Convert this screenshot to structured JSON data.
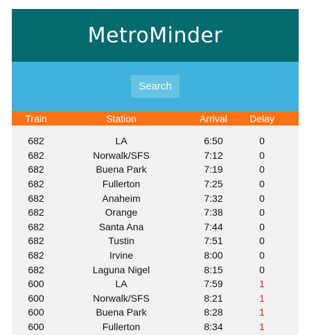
{
  "app": {
    "title": "MetroMinder"
  },
  "search": {
    "button_label": "Search"
  },
  "colors": {
    "header": "#036a6e",
    "search_bar": "#3fb3dc",
    "table_header": "#fd7217",
    "delay": "#e61e1e"
  },
  "table": {
    "headers": {
      "train": "Train",
      "station": "Station",
      "arrival": "Arrival",
      "delay": "Delay"
    },
    "rows": [
      {
        "train": "682",
        "station": "LA",
        "arrival": "6:50",
        "delay": "0"
      },
      {
        "train": "682",
        "station": "Norwalk/SFS",
        "arrival": "7:12",
        "delay": "0"
      },
      {
        "train": "682",
        "station": "Buena Park",
        "arrival": "7:19",
        "delay": "0"
      },
      {
        "train": "682",
        "station": "Fullerton",
        "arrival": "7:25",
        "delay": "0"
      },
      {
        "train": "682",
        "station": "Anaheim",
        "arrival": "7:32",
        "delay": "0"
      },
      {
        "train": "682",
        "station": "Orange",
        "arrival": "7:38",
        "delay": "0"
      },
      {
        "train": "682",
        "station": "Santa Ana",
        "arrival": "7:44",
        "delay": "0"
      },
      {
        "train": "682",
        "station": "Tustin",
        "arrival": "7:51",
        "delay": "0"
      },
      {
        "train": "682",
        "station": "Irvine",
        "arrival": "8:00",
        "delay": "0"
      },
      {
        "train": "682",
        "station": "Laguna Nigel",
        "arrival": "8:15",
        "delay": "0"
      },
      {
        "train": "600",
        "station": "LA",
        "arrival": "7:59",
        "delay": "1"
      },
      {
        "train": "600",
        "station": "Norwalk/SFS",
        "arrival": "8:21",
        "delay": "1"
      },
      {
        "train": "600",
        "station": "Buena Park",
        "arrival": "8:28",
        "delay": "1"
      },
      {
        "train": "600",
        "station": "Fullerton",
        "arrival": "8:34",
        "delay": "1"
      }
    ]
  }
}
